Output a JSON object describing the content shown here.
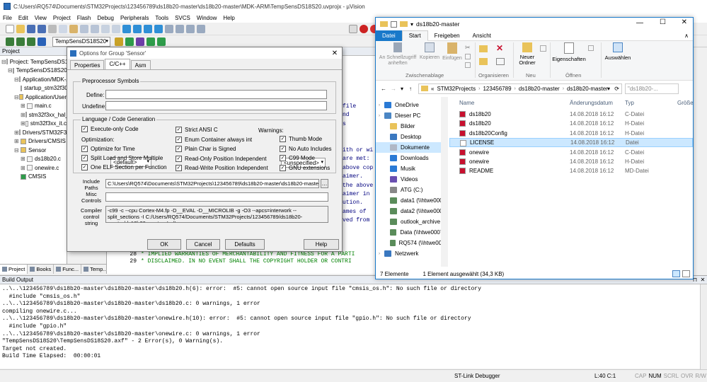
{
  "uv": {
    "title": "C:\\Users\\RQ574\\Documents\\STM32Projects\\123456789\\ds18b20-master\\ds18b20-master\\MDK-ARM\\TempSensDS18S20.uvprojx - µVision",
    "menu": [
      "File",
      "Edit",
      "View",
      "Project",
      "Flash",
      "Debug",
      "Peripherals",
      "Tools",
      "SVCS",
      "Window",
      "Help"
    ],
    "target": "TempSensDS18S20",
    "project_header": "Project",
    "tree": [
      {
        "label": "Project: TempSensDS18S20",
        "lvl": 0,
        "t": "pj",
        "ex": "⊟"
      },
      {
        "label": "TempSensDS18S20",
        "lvl": 1,
        "t": "tg",
        "ex": "⊟"
      },
      {
        "label": "Application/MDK-ARM",
        "lvl": 2,
        "t": "fd",
        "ex": "⊟"
      },
      {
        "label": "startup_stm32f303xe.s",
        "lvl": 3,
        "t": "fl",
        "ex": ""
      },
      {
        "label": "Application/User",
        "lvl": 2,
        "t": "fd",
        "ex": "⊟"
      },
      {
        "label": "main.c",
        "lvl": 3,
        "t": "fl",
        "ex": "⊞"
      },
      {
        "label": "stm32f3xx_hal_msp.c",
        "lvl": 3,
        "t": "fl",
        "ex": "⊞"
      },
      {
        "label": "stm32f3xx_it.c",
        "lvl": 3,
        "t": "fl",
        "ex": "⊞"
      },
      {
        "label": "Drivers/STM32F3xx_HAL_Driver",
        "lvl": 2,
        "t": "fd",
        "ex": "⊞"
      },
      {
        "label": "Drivers/CMSIS",
        "lvl": 2,
        "t": "fd",
        "ex": "⊞"
      },
      {
        "label": "Sensor",
        "lvl": 2,
        "t": "fd",
        "ex": "⊟"
      },
      {
        "label": "ds18b20.c",
        "lvl": 3,
        "t": "fl",
        "ex": "⊞"
      },
      {
        "label": "onewire.c",
        "lvl": 3,
        "t": "fl",
        "ex": "⊞"
      },
      {
        "label": "CMSIS",
        "lvl": 2,
        "t": "gm",
        "ex": ""
      }
    ],
    "panel_tabs": [
      "Project",
      "Books",
      "Func...",
      "Temp..."
    ],
    "code_right": [
      "file",
      "nd",
      "s",
      "",
      "",
      "ith or wi",
      "are met:",
      "above cop",
      "aimer.",
      "the above",
      "aimer in",
      "ution.",
      "ames of",
      "ved from"
    ],
    "code_lines": [
      {
        "n": "",
        "t": "  ND CONTRI"
      },
      {
        "n": "",
        "t": "  T NOT LIM"
      },
      {
        "n": "28",
        "t": " * IMPLIED WARRANTIES OF MERCHANTABILITY AND FITNESS FOR A PARTI"
      },
      {
        "n": "29",
        "t": " * DISCLAIMED. IN NO EVENT SHALL THE COPYRIGHT HOLDER OR CONTRI"
      }
    ],
    "build_header": "Build Output",
    "build_lines": [
      "..\\..\\123456789\\ds18b20-master\\ds18b20-master\\ds18b20.h(6): error:  #5: cannot open source input file \"cmsis_os.h\": No such file or directory",
      "  #include \"cmsis_os.h\"",
      "..\\..\\123456789\\ds18b20-master\\ds18b20-master\\ds18b20.c: 0 warnings, 1 error",
      "compiling onewire.c...",
      "..\\..\\123456789\\ds18b20-master\\ds18b20-master\\onewire.h(10): error:  #5: cannot open source input file \"gpio.h\": No such file or directory",
      "  #include \"gpio.h\"",
      "..\\..\\123456789\\ds18b20-master\\ds18b20-master\\onewire.c: 0 warnings, 1 error",
      "\"TempSensDS18S20\\TempSensDS18S20.axf\" - 2 Error(s), 0 Warning(s).",
      "Target not created.",
      "Build Time Elapsed:  00:00:01"
    ],
    "status": {
      "debugger": "ST-Link Debugger",
      "pos": "L:40 C:1",
      "flags": [
        "CAP",
        "NUM",
        "SCRL",
        "OVR",
        "R/W"
      ]
    }
  },
  "dlg": {
    "title": "Options for Group 'Sensor'",
    "tabs": [
      "Properties",
      "C/C++",
      "Asm"
    ],
    "pre_group": "Preprocessor Symbols",
    "define_label": "Define:",
    "undefine_label": "Undefine:",
    "lang_group": "Language / Code Generation",
    "execute_only": "Execute-only Code",
    "opt_label": "Optimization:",
    "opt_value": "<default>",
    "col1": [
      {
        "l": "Optimize for Time",
        "c": "✓"
      },
      {
        "l": "Split Load and Store Multiple",
        "c": "✓"
      },
      {
        "l": "One ELF Section per Function",
        "c": "✓"
      }
    ],
    "col2": [
      {
        "l": "Strict ANSI C",
        "c": "✓"
      },
      {
        "l": "Enum Container always int",
        "c": "✓"
      },
      {
        "l": "Plain Char is Signed",
        "c": "✓"
      },
      {
        "l": "Read-Only Position Independent",
        "c": "✓"
      },
      {
        "l": "Read-Write Position Independent",
        "c": "✓"
      }
    ],
    "warn_label": "Warnings:",
    "warn_value": "<unspecified>",
    "col3": [
      {
        "l": "Thumb Mode",
        "c": "✓"
      },
      {
        "l": "No Auto Includes",
        "c": "✓"
      },
      {
        "l": "C99 Mode",
        "c": "✓"
      },
      {
        "l": "GNU extensions",
        "c": "✓"
      }
    ],
    "include_label": "Include Paths",
    "include_value": "C:\\Users\\RQ574\\Documents\\STM32Projects\\123456789\\ds18b20-master\\ds18b20-master",
    "misc_label": "Misc Controls",
    "compiler_label": "Compiler control string",
    "compiler_value": "-c99 -c --cpu Cortex-M4.fp -D__EVAL -D__MICROLIB -g -O3 --apcs=interwork --split_sections -I C:/Users/RQ574/Documents/STM32Projects/123456789/ds18b20-master/ds18b20-master -I ../Inc",
    "buttons": [
      "OK",
      "Cancel",
      "Defaults",
      "Help"
    ]
  },
  "exp": {
    "title": "ds18b20-master",
    "tabs": [
      "Datei",
      "Start",
      "Freigeben",
      "Ansicht"
    ],
    "ribbon": {
      "pin": "An Schnellzugriff anheften",
      "copy": "Kopieren",
      "paste": "Einfügen",
      "clip_group": "Zwischenablage",
      "org_group": "Organisieren",
      "new_folder": "Neuer Ordner",
      "new_group": "Neu",
      "props": "Eigenschaften",
      "open_group": "Öffnen",
      "select": "Auswählen"
    },
    "path": [
      "«",
      "STM32Projects",
      "123456789",
      "ds18b20-master",
      "ds18b20-master"
    ],
    "search_placeholder": "\"ds18b20-...",
    "nav": [
      {
        "l": "OneDrive",
        "t": "cloud",
        "d": 0
      },
      {
        "l": "Dieser PC",
        "t": "pc",
        "d": 0
      },
      {
        "l": "Bilder",
        "t": "folder",
        "d": 1
      },
      {
        "l": "Desktop",
        "t": "desk",
        "d": 1
      },
      {
        "l": "Dokumente",
        "t": "docs",
        "d": 1,
        "sel": true
      },
      {
        "l": "Downloads",
        "t": "down",
        "d": 1
      },
      {
        "l": "Musik",
        "t": "music",
        "d": 1
      },
      {
        "l": "Videos",
        "t": "video",
        "d": 1
      },
      {
        "l": "ATG (C:)",
        "t": "drive",
        "d": 1
      },
      {
        "l": "data1 (\\\\htwe0006.",
        "t": "net",
        "d": 1
      },
      {
        "l": "data2 (\\\\htwe0007.",
        "t": "net",
        "d": 1
      },
      {
        "l": "outlook_archive (\\\\",
        "t": "net",
        "d": 1
      },
      {
        "l": "Data (\\\\htwe0007.a",
        "t": "net",
        "d": 1
      },
      {
        "l": "RQ574 (\\\\htwe0007",
        "t": "net",
        "d": 1
      },
      {
        "l": "Netzwerk",
        "t": "netw",
        "d": 0
      }
    ],
    "columns": [
      "Name",
      "Änderungsdatum",
      "Typ",
      "Größe"
    ],
    "files": [
      {
        "name": "ds18b20",
        "date": "14.08.2018 16:12",
        "type": "C-Datei",
        "icon": "c"
      },
      {
        "name": "ds18b20",
        "date": "14.08.2018 16:12",
        "type": "H-Datei",
        "icon": "h"
      },
      {
        "name": "ds18b20Config",
        "date": "14.08.2018 16:12",
        "type": "H-Datei",
        "icon": "h"
      },
      {
        "name": "LICENSE",
        "date": "14.08.2018 16:12",
        "type": "Datei",
        "icon": "blank",
        "sel": true
      },
      {
        "name": "onewire",
        "date": "14.08.2018 16:12",
        "type": "C-Datei",
        "icon": "c"
      },
      {
        "name": "onewire",
        "date": "14.08.2018 16:12",
        "type": "H-Datei",
        "icon": "h"
      },
      {
        "name": "README",
        "date": "14.08.2018 16:12",
        "type": "MD-Datei",
        "icon": "md"
      }
    ],
    "status_count": "7 Elemente",
    "status_sel": "1 Element ausgewählt (34,3 KB)"
  },
  "colors": {
    "accent": "#1979ca",
    "selection": "#cce8ff",
    "red": "#c8102e",
    "tree_sel": "#3399ff"
  }
}
